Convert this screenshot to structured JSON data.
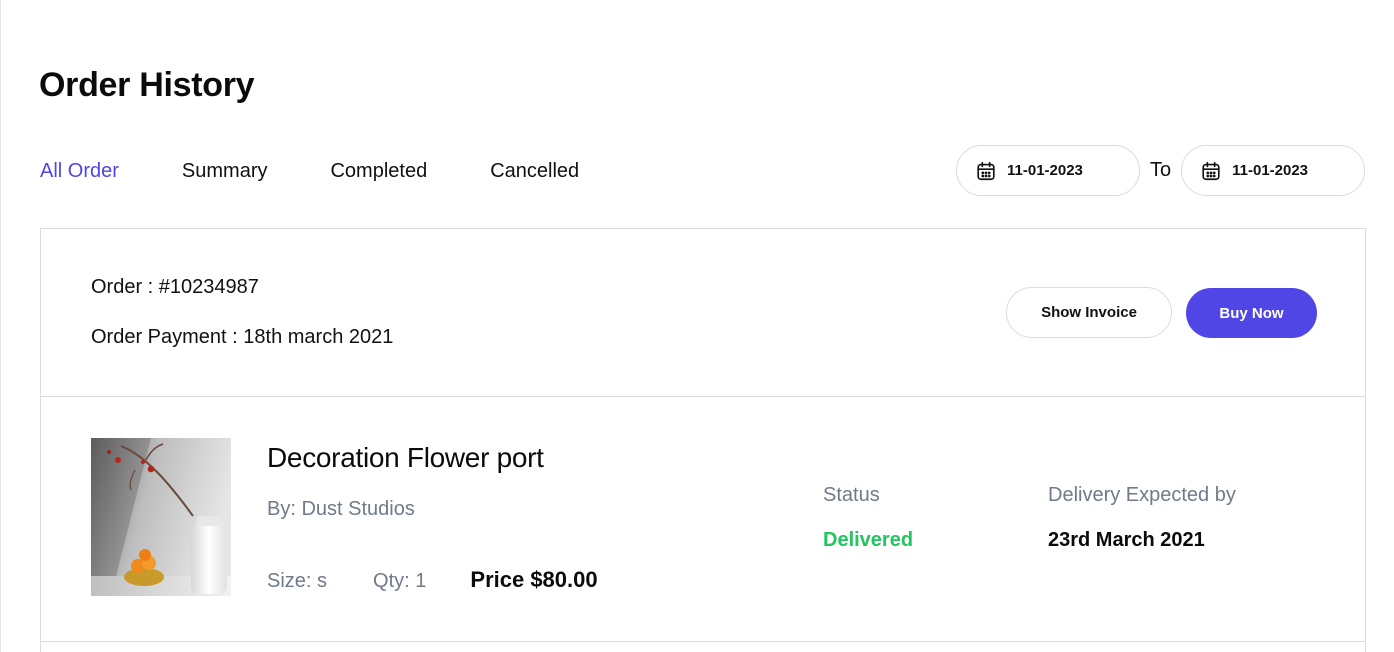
{
  "page": {
    "title": "Order History"
  },
  "tabs": [
    {
      "label": "All Order",
      "active": true
    },
    {
      "label": "Summary",
      "active": false
    },
    {
      "label": "Completed",
      "active": false
    },
    {
      "label": "Cancelled",
      "active": false
    }
  ],
  "date_range": {
    "from": "11-01-2023",
    "separator": "To",
    "to": "11-01-2023",
    "icon": "calendar-icon"
  },
  "order": {
    "number_text": "Order : #10234987",
    "payment_text": "Order Payment : 18th march 2021",
    "show_invoice_label": "Show Invoice",
    "buy_now_label": "Buy Now",
    "items": [
      {
        "name": "Decoration Flower port",
        "vendor": "By: Dust Studios",
        "size": "Size: s",
        "qty": "Qty: 1",
        "price": "Price $80.00",
        "status_label": "Status",
        "status_value": "Delivered",
        "delivery_label": "Delivery Expected by",
        "delivery_value": "23rd March 2021"
      }
    ]
  },
  "colors": {
    "accent": "#4f46e5",
    "status_delivered": "#22c55e",
    "muted_text": "#707a88",
    "border": "#dcdcdc"
  }
}
